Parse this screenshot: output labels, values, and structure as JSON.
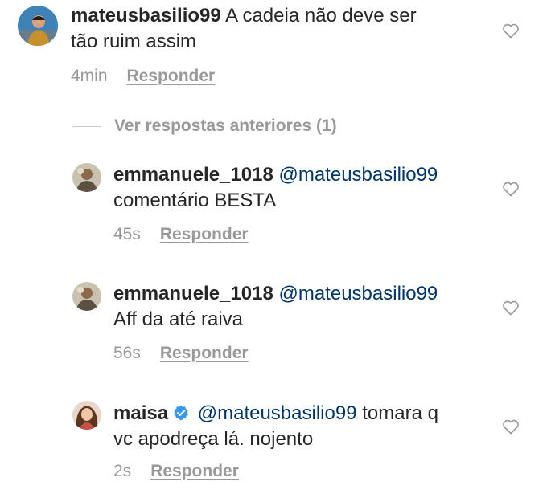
{
  "comments": [
    {
      "username": "mateusbasilio99",
      "text": "A cadeia não deve ser",
      "text2": "tão ruim assim",
      "time": "4min",
      "reply_label": "Responder"
    },
    {
      "username": "emmanuele_1018",
      "mention": "@mateusbasilio99",
      "text": "comentário BESTA",
      "time": "45s",
      "reply_label": "Responder"
    },
    {
      "username": "emmanuele_1018",
      "mention": "@mateusbasilio99",
      "text": "Aff da até raiva",
      "time": "56s",
      "reply_label": "Responder"
    },
    {
      "username": "maisa",
      "verified": true,
      "mention": "@mateusbasilio99",
      "text": "tomara q",
      "text2": "vc apodreça lá. nojento",
      "time": "2s",
      "reply_label": "Responder"
    }
  ],
  "view_previous_replies": "Ver respostas anteriores (1)",
  "colors": {
    "text": "#262626",
    "mention": "#003569",
    "meta": "#999999",
    "verified": "#3897f0"
  },
  "icons": {
    "like": "heart-outline-icon",
    "verified": "verified-badge-icon"
  }
}
